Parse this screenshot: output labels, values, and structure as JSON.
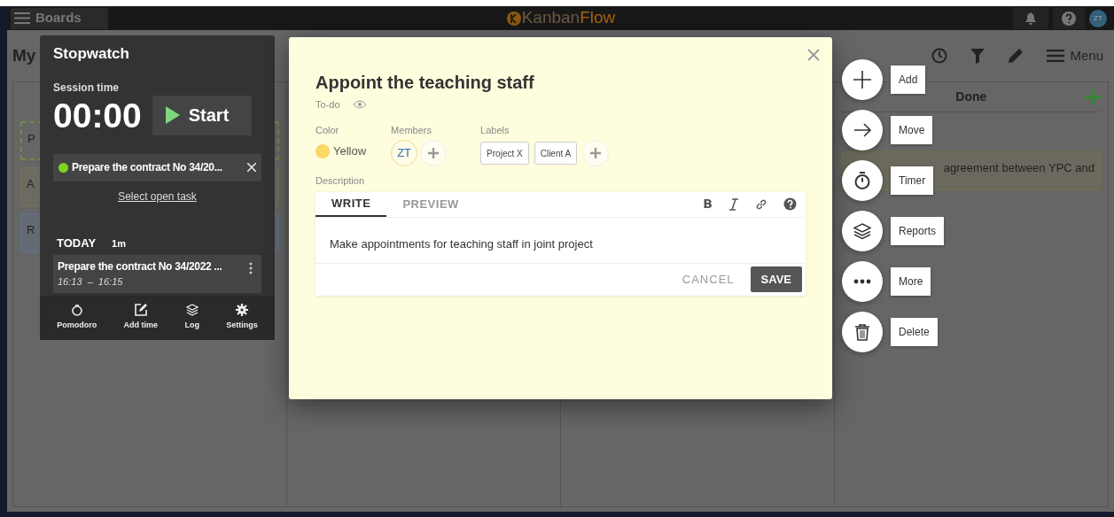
{
  "topbar": {
    "boards_button": "Boards",
    "logo": [
      "Kanban",
      "Flow"
    ],
    "avatar": "ZT"
  },
  "board": {
    "title": "My",
    "menu": "Menu",
    "columns": [
      {
        "cards": [
          {
            "text": "P",
            "kind": "dashed",
            "color": "#6f8a4a"
          },
          {
            "text": "A",
            "kind": "solid",
            "color": "#7a7256"
          },
          {
            "text": "R",
            "kind": "solid",
            "color": "#5f7190"
          }
        ]
      },
      {},
      {},
      {
        "header": "Done",
        "cards": [
          {
            "text": "agreement between YPC and",
            "kind": "solid",
            "color": "#75704c"
          }
        ]
      }
    ]
  },
  "stopwatch": {
    "title": "Stopwatch",
    "session_label": "Session time",
    "time": "00:00",
    "start_button": "Start",
    "current_task": {
      "text": "Prepare the contract No 34/20...",
      "color": "#7ed321"
    },
    "select_link": "Select open task",
    "today_label": "TODAY",
    "today_total": "1m",
    "entries": [
      {
        "task": "Prepare the contract No 34/2022 ...",
        "time_range": "16:13  –  16:15"
      }
    ],
    "footer": [
      {
        "label": "Pomodoro",
        "kind": "pomodoro"
      },
      {
        "label": "Add time",
        "kind": "add_time"
      },
      {
        "label": "Log",
        "kind": "log"
      },
      {
        "label": "Settings",
        "kind": "settings"
      }
    ]
  },
  "task": {
    "title": "Appoint the teaching staff",
    "column": "To-do",
    "color": {
      "label": "Color",
      "value": "Yellow",
      "color": "#f9d867"
    },
    "members": {
      "label": "Members",
      "items": [
        "ZT"
      ]
    },
    "labels": {
      "label": "Labels",
      "items": [
        "Project X",
        "Client A"
      ]
    },
    "description": {
      "label": "Description",
      "tabs": [
        {
          "label": "WRITE",
          "selected": true
        },
        {
          "label": "PREVIEW",
          "selected": false
        }
      ],
      "bold_button": "B",
      "text": "Make appointments for teaching staff in joint project",
      "cancel": "CANCEL",
      "save": "SAVE"
    }
  },
  "actions": [
    {
      "label": "Add",
      "kind": "add"
    },
    {
      "label": "Move",
      "kind": "move"
    },
    {
      "label": "Timer",
      "kind": "timer"
    },
    {
      "label": "Reports",
      "kind": "reports"
    },
    {
      "label": "More",
      "kind": "more"
    },
    {
      "label": "Delete",
      "kind": "delete"
    }
  ]
}
